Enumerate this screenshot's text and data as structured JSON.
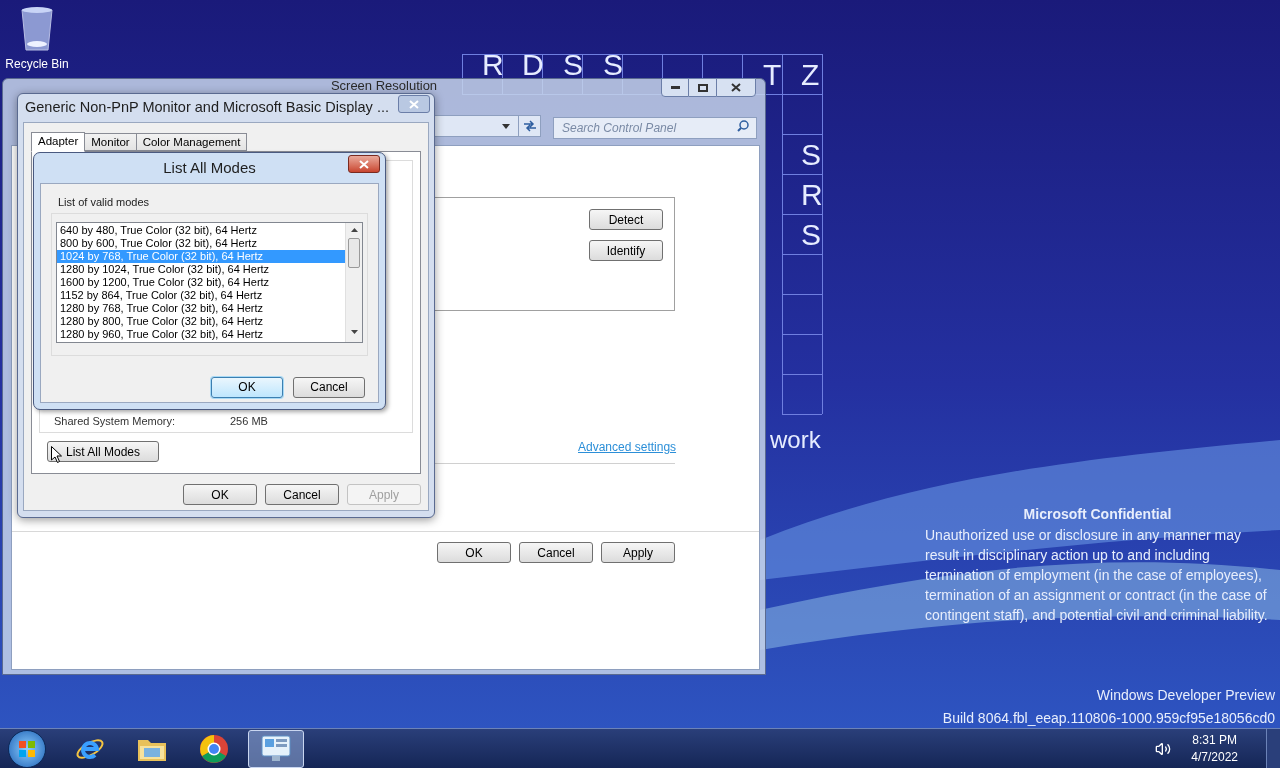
{
  "desktop": {
    "icons": [
      {
        "label": "Recycle Bin"
      }
    ],
    "wallpaper_letters": [
      {
        "text": "R"
      },
      {
        "text": "D"
      },
      {
        "text": "S"
      },
      {
        "text": "S"
      },
      {
        "text": "T"
      },
      {
        "text": "Z"
      },
      {
        "text": "S"
      },
      {
        "text": "R"
      },
      {
        "text": "S"
      },
      {
        "text": "work"
      }
    ],
    "notice": {
      "title": "Microsoft Confidential",
      "text": "Unauthorized use or disclosure in any manner may result in disciplinary action up to and including termination of employment (in the case of employees), termination of an assignment or contract (in the case of contingent staff), and potential civil and criminal liability."
    },
    "build_info": [
      "Windows Developer Preview",
      "Build 8064.fbl_eeap.110806-1000.959cf95e18056cd0"
    ]
  },
  "screen_resolution_window": {
    "title": "Screen Resolution",
    "search": {
      "placeholder": "Search Control Panel"
    },
    "side_buttons": [
      "Detect",
      "Identify"
    ],
    "advanced_link": "Advanced settings",
    "buttons": [
      "OK",
      "Cancel",
      "Apply"
    ]
  },
  "properties_dialog": {
    "title": "Generic Non-PnP Monitor and Microsoft Basic Display ...",
    "tabs": [
      {
        "label": "Adapter",
        "selected": true
      },
      {
        "label": "Monitor",
        "selected": false
      },
      {
        "label": "Color Management",
        "selected": false
      }
    ],
    "shared_memory": {
      "label": "Shared System Memory:",
      "value": "256 MB"
    },
    "list_modes_button": "List All Modes",
    "buttons": [
      {
        "label": "OK",
        "disabled": false
      },
      {
        "label": "Cancel",
        "disabled": false
      },
      {
        "label": "Apply",
        "disabled": true
      }
    ]
  },
  "list_modes_dialog": {
    "title": "List All Modes",
    "group_label": "List of valid modes",
    "modes": [
      {
        "text": "640 by 480, True Color (32 bit), 64 Hertz",
        "selected": false
      },
      {
        "text": "800 by 600, True Color (32 bit), 64 Hertz",
        "selected": false
      },
      {
        "text": "1024 by 768, True Color (32 bit), 64 Hertz",
        "selected": true
      },
      {
        "text": "1280 by 1024, True Color (32 bit), 64 Hertz",
        "selected": false
      },
      {
        "text": "1600 by 1200, True Color (32 bit), 64 Hertz",
        "selected": false
      },
      {
        "text": "1152 by 864, True Color (32 bit), 64 Hertz",
        "selected": false
      },
      {
        "text": "1280 by 768, True Color (32 bit), 64 Hertz",
        "selected": false
      },
      {
        "text": "1280 by 800, True Color (32 bit), 64 Hertz",
        "selected": false
      },
      {
        "text": "1280 by 960, True Color (32 bit), 64 Hertz",
        "selected": false
      }
    ],
    "buttons": [
      {
        "label": "OK",
        "default": true
      },
      {
        "label": "Cancel",
        "default": false
      }
    ]
  },
  "taskbar": {
    "apps": [
      {
        "kind": "browser",
        "active": false
      },
      {
        "kind": "folder",
        "active": false
      },
      {
        "kind": "chrome",
        "active": false
      },
      {
        "kind": "control_panel",
        "active": true
      }
    ],
    "time": "8:31 PM",
    "date": "4/7/2022"
  }
}
